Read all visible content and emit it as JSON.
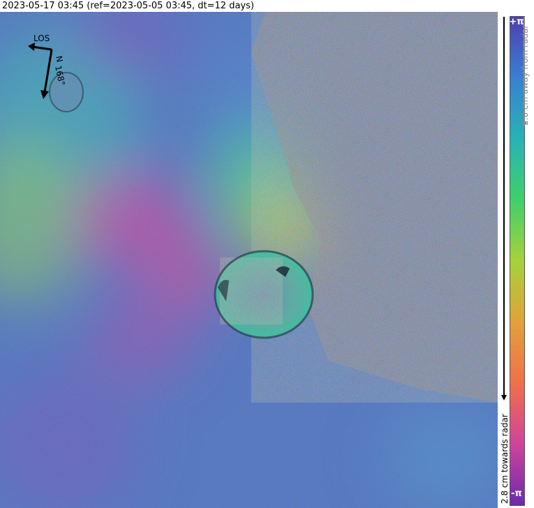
{
  "title": "2023-05-17 03:45 (ref=2023-05-05 03:45, dt=12 days)",
  "compass": {
    "los_label": "LOS",
    "north_label": "N",
    "heading_label": "168°"
  },
  "colorbar": {
    "top_label": "+π",
    "bottom_label": "-π",
    "away_label": "2.8 cm away from radar",
    "towards_label": "2.8 cm towards radar",
    "colors": [
      "#4f3fb0",
      "#3a7fd0",
      "#27b3b8",
      "#3fd06a",
      "#a6d23a",
      "#e0a23a",
      "#f0704a",
      "#d0449a",
      "#6a2ab0"
    ]
  },
  "map": {
    "feature": "crater-rim",
    "background_colors": {
      "blue": "#4a6fc4",
      "teal": "#3aa8b8",
      "magenta": "#b34aa8",
      "green": "#7fd060",
      "yellow": "#c9b040"
    }
  }
}
